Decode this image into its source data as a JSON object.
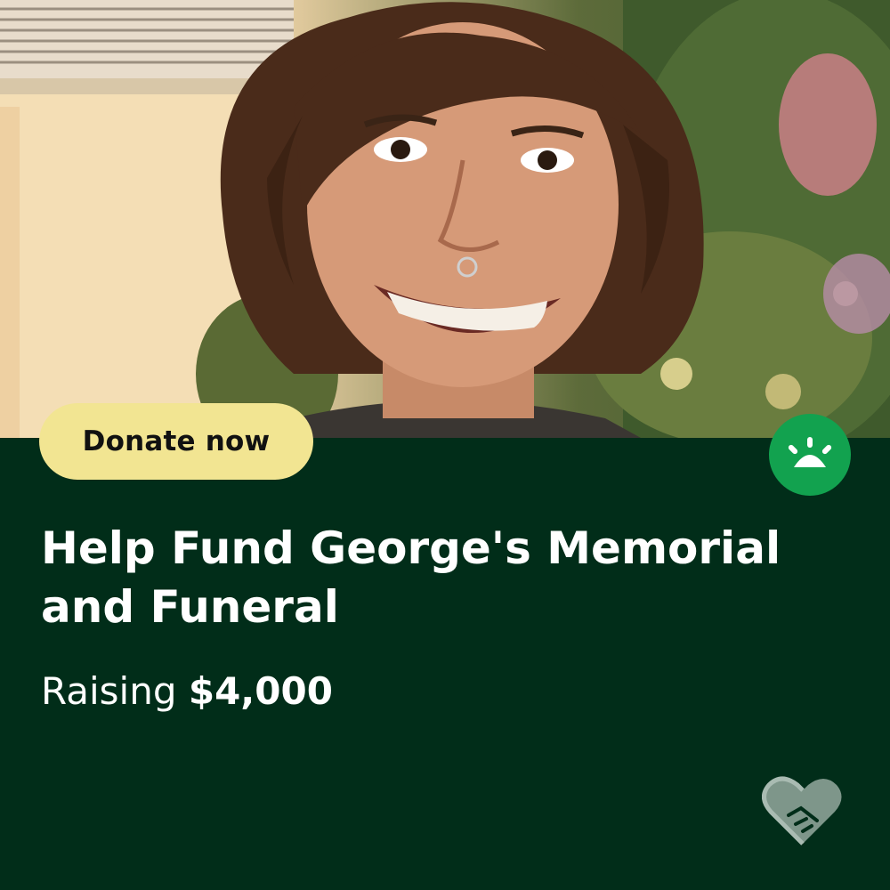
{
  "photo": {
    "alt": "Smiling young man with wavy brown hair in front of a Christmas tree"
  },
  "cta": {
    "label": "Donate now",
    "color": "#f2e592"
  },
  "brand": {
    "badge_color": "#12a24f",
    "icon": "gofundme-sun-logo-icon"
  },
  "campaign": {
    "title": "Help Fund George's Memorial and Funeral",
    "raising_label": "Raising",
    "goal": "$4,000"
  },
  "footer": {
    "icon": "heart-handshake-icon"
  },
  "colors": {
    "panel": "#012d19",
    "text": "#ffffff"
  }
}
